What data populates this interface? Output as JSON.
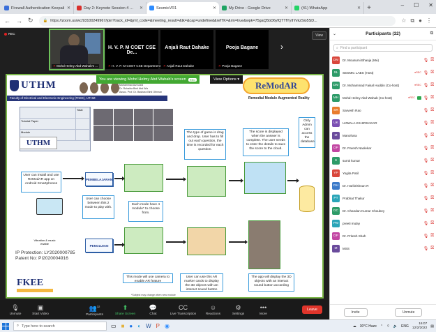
{
  "browser": {
    "tabs": [
      {
        "title": "Firewall Authentication Keepali",
        "color": "#3b6fd9",
        "active": false
      },
      {
        "title": "Day 2: Keynote Session 4 @ 2.3",
        "color": "#d9302c",
        "active": false
      },
      {
        "title": "SesmicVR1",
        "color": "#2d8cff",
        "active": true
      },
      {
        "title": "My Drive - Google Drive",
        "color": "#1fa463",
        "active": false
      },
      {
        "title": "(41) WhatsApp",
        "color": "#25d366",
        "active": false
      }
    ],
    "url": "https://zoom.us/wc/93100249967/join?track_id=&jmf_code=&meeting_result=&tk=&cap=undefined&refTK=&rm=true&wpk=75gaQ5bD6yfQTTfYyIIYvkzSio5SD...",
    "window_controls": {
      "minimize": "–",
      "maximize": "☐",
      "close": "✕"
    }
  },
  "zoom": {
    "recording_label": "REC",
    "view_button": "View",
    "next_arrow": "›",
    "tiles": [
      {
        "name": "",
        "label": "Mohd Helmy Abd Wahab's ...",
        "camera": true,
        "selected": true
      },
      {
        "name": "H. V. P. M COET CSE De...",
        "label": "H. V. P. M COET CSE Department",
        "camera": false
      },
      {
        "name": "Anjali Raut Dahake",
        "label": "Anjali Raut Dahake",
        "camera": false
      },
      {
        "name": "Pooja Bagane",
        "label": "Pooja Bagane",
        "camera": false
      }
    ],
    "share_banner": "You are viewing Mohd Helmy Abd Wahab's screen",
    "share_banner_tag": "REC",
    "view_options": "View Options",
    "toolbar": {
      "unmute": "Unmute",
      "start_video": "Start Video",
      "participants": "Participants",
      "participants_count": "32",
      "share_screen": "Share Screen",
      "chat": "Chat",
      "live_transcription": "Live Transcription",
      "reactions": "Reactions",
      "settings": "Settings",
      "more": "More",
      "leave": "Leave"
    }
  },
  "poster": {
    "uthm": "UTHM",
    "faculty": "Faculty of Electrical and Electronic Engineering (FKEE), UTHM",
    "credits": [
      "Muhammad Aizil Azid",
      "Dr. Rohaida Binti Abd Wiz",
      "Assoc. Prof. Dr. Bashara Binti Othman"
    ],
    "remod_title": "ReModAR",
    "remod_subtitle": "Remedial Module Augmented Reality",
    "total_header": "Total",
    "table_rows": [
      "",
      "Tutorial Paper",
      "Module"
    ],
    "callouts": {
      "install": "User can install and use ReModAR app on Android Smartphones",
      "choose_mode": "User can choose between this 2 mode to play with.",
      "module_count": "Each mode have 4 module* to choose from.",
      "drag_drop": "The type of game is drag and drop. User has to fill out each question, the time is recorded for each question.",
      "score": "The score is displayed when the answer is complete. The user needs to enter the details to save the score to the cloud.",
      "admin": "Only Admin can access the database",
      "camera": "This mode will use camera to enable AR feature",
      "marker": "User can use this AR marker cards to display the 3D objects with an interact sound button",
      "app_display": "The app will display the 3D objects with an interact sound button according",
      "vibration": "Vibration & music enable"
    },
    "mode1": "PEMBELAJARAN",
    "mode2": "PENGUJIAN",
    "ip_protection": "IP Protection: LY2020000785",
    "patent_no": "Patent No: PI2020004916",
    "fkee": "FKEE",
    "footnote": "*Subject may change when new module"
  },
  "participants": {
    "title": "Participants (32)",
    "search_placeholder": "Find a participant",
    "list": [
      {
        "initials": "DM",
        "name": "Dr. Mousumi Bhanja (Me)",
        "color": "#d9473c",
        "rec": false,
        "video": false
      },
      {
        "initials": "SL",
        "name": "SESMIC LABS (Host)",
        "color": "#2d9b68",
        "rec": true,
        "video": false
      },
      {
        "initials": "DM",
        "name": "Dr. Mohammad Faisal Huddin (Co-host)",
        "color": "#2d9b68",
        "rec": true,
        "video": false
      },
      {
        "initials": "MH",
        "name": "Mohd Helmy Abd Wahab (Co-host)",
        "color": "#2d9b68",
        "rec": true,
        "video": true
      },
      {
        "initials": "SR",
        "name": "Sarvesh Rao",
        "color": "#e97c2c",
        "rec": false,
        "video": false
      },
      {
        "initials": "UK",
        "name": "UJWALA KSHIRSAGAR",
        "color": "#7b4fb3",
        "rec": false,
        "video": false
      },
      {
        "initials": "M",
        "name": "Manohara",
        "color": "#6a4b9c",
        "rec": false,
        "video": false
      },
      {
        "initials": "DP",
        "name": "Dr. Paresh Naolekar",
        "color": "#c247a3",
        "rec": false,
        "video": false
      },
      {
        "initials": "S",
        "name": "sumit kumar",
        "color": "#2d9b68",
        "rec": false,
        "video": false
      },
      {
        "initials": "YP",
        "name": "Yogita Patil",
        "color": "#d9473c",
        "rec": false,
        "video": false
      },
      {
        "initials": "DH",
        "name": "Dr. Harikrishnan R",
        "color": "#3b7ac9",
        "rec": false,
        "video": false
      },
      {
        "initials": "PT",
        "name": "Prabhat Thakur",
        "color": "#2aa5b8",
        "rec": false,
        "video": false
      },
      {
        "initials": "DC",
        "name": "Dr. Chandan Kumar Choubey",
        "color": "#2d9b68",
        "rec": false,
        "video": false
      },
      {
        "initials": "PM",
        "name": "preeti mulay",
        "color": "#2aa5b8",
        "rec": false,
        "video": false
      },
      {
        "initials": "DP",
        "name": "Dr. Pritesh Shah",
        "color": "#c247a3",
        "rec": false,
        "video": false
      },
      {
        "initials": "M",
        "name": "MSS",
        "color": "#6a4b9c",
        "rec": false,
        "video": false
      }
    ],
    "invite": "Invite",
    "unmute": "Unmute"
  },
  "taskbar": {
    "search_placeholder": "Type here to search",
    "weather": "30°C Haze",
    "lang": "ENG",
    "time": "16:07",
    "date": "12/2/2022"
  }
}
